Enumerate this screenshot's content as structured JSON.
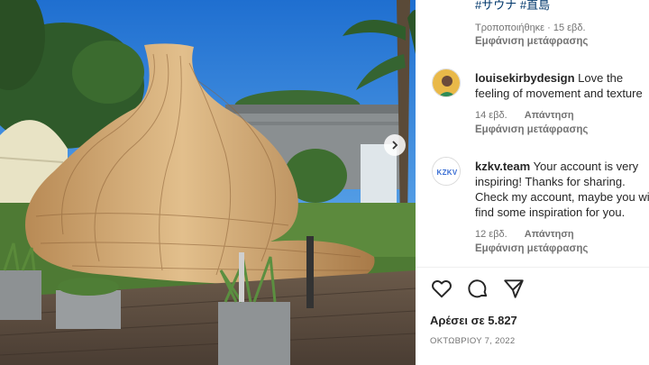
{
  "post": {
    "tags": "#サウナ #直島",
    "caption_meta": "Τροποποιήθηκε · 15 εβδ.",
    "caption_translate": "Εμφάνιση μετάφρασης"
  },
  "comments": [
    {
      "username": "louisekirbydesign",
      "text": "Love the feeling of movement and texture",
      "time": "14 εβδ.",
      "reply": "Απάντηση",
      "translate": "Εμφάνιση μετάφρασης"
    },
    {
      "username": "kzkv.team",
      "text": "Your account is very inspiring! Thanks for sharing. Check my account, maybe you will find some inspiration for you.",
      "time": "12 εβδ.",
      "reply": "Απάντηση",
      "translate": "Εμφάνιση μετάφρασης",
      "avatar_text": "KZKV"
    }
  ],
  "engagement": {
    "likes": "Αρέσει σε 5.827",
    "date": "ΟΚΤΩΒΡΙΟΥ 7, 2022"
  },
  "icons": {
    "like": "heart-icon",
    "comment": "comment-bubble-icon",
    "share": "paper-plane-icon",
    "next": "chevron-right-icon"
  },
  "colors": {
    "link": "#00376b",
    "text": "#262626",
    "muted": "#737373",
    "sky": "#2f7fd6"
  }
}
